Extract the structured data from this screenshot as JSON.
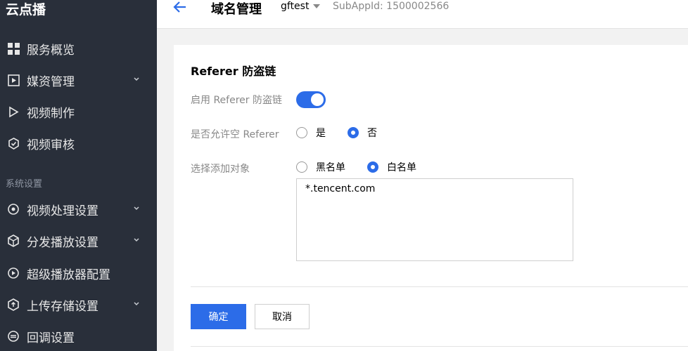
{
  "sidebar": {
    "brand": "云点播",
    "items": [
      {
        "label": "服务概览",
        "icon": "grid-icon"
      },
      {
        "label": "媒资管理",
        "icon": "media-icon"
      },
      {
        "label": "视频制作",
        "icon": "play-icon"
      },
      {
        "label": "视频审核",
        "icon": "shield-check-icon"
      },
      {
        "label": "视频处理设置",
        "icon": "process-icon"
      },
      {
        "label": "分发播放设置",
        "icon": "cube-icon"
      },
      {
        "label": "超级播放器配置",
        "icon": "player-icon"
      },
      {
        "label": "上传存储设置",
        "icon": "upload-icon"
      },
      {
        "label": "回调设置",
        "icon": "callback-icon"
      }
    ],
    "section_label": "系统设置"
  },
  "header": {
    "title": "域名管理",
    "app_name": "gftest",
    "subappid": "SubAppId: 1500002566"
  },
  "card": {
    "title": "Referer 防盗链",
    "enable_label": "启用 Referer 防盗链",
    "enable_on": true,
    "allow_empty_label": "是否允许空 Referer",
    "allow_empty_options": [
      "是",
      "否"
    ],
    "allow_empty_selected": "否",
    "target_label": "选择添加对象",
    "target_options": [
      "黑名单",
      "白名单"
    ],
    "target_selected": "白名单",
    "domains_value": "*.tencent.com",
    "confirm_label": "确定",
    "cancel_label": "取消"
  },
  "colors": {
    "accent": "#2c6ce8",
    "sidebar_bg": "#292f3a"
  }
}
